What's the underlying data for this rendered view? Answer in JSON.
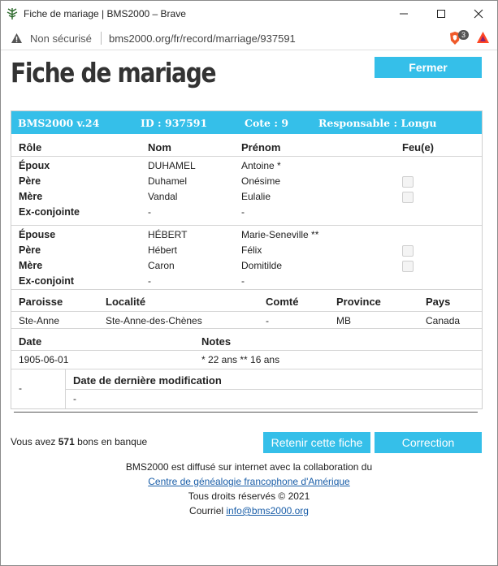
{
  "window": {
    "title": "Fiche de mariage | BMS2000 – Brave"
  },
  "addressbar": {
    "security": "Non sécurisé",
    "url": "bms2000.org/fr/record/marriage/937591",
    "shield_count": "3"
  },
  "page": {
    "title": "Fiche de mariage",
    "close_label": "Fermer",
    "record_header": {
      "version": "BMS2000 v.24",
      "id": "ID : 937591",
      "cote": "Cote : 9",
      "responsable": "Responsable : Longu"
    },
    "columns": {
      "role": "Rôle",
      "nom": "Nom",
      "prenom": "Prénom",
      "feu": "Feu(e)"
    },
    "groom": [
      {
        "role": "Époux",
        "nom": "DUHAMEL",
        "prenom": "Antoine *"
      },
      {
        "role": "Père",
        "nom": "Duhamel",
        "prenom": "Onésime"
      },
      {
        "role": "Mère",
        "nom": "Vandal",
        "prenom": "Eulalie"
      },
      {
        "role": "Ex-conjointe",
        "nom": "-",
        "prenom": "-"
      }
    ],
    "bride": [
      {
        "role": "Épouse",
        "nom": "HÉBERT",
        "prenom": "Marie-Seneville **"
      },
      {
        "role": "Père",
        "nom": "Hébert",
        "prenom": "Félix"
      },
      {
        "role": "Mère",
        "nom": "Caron",
        "prenom": "Domitilde"
      },
      {
        "role": "Ex-conjoint",
        "nom": "-",
        "prenom": "-"
      }
    ],
    "place": {
      "headers": {
        "paroisse": "Paroisse",
        "localite": "Localité",
        "comte": "Comté",
        "province": "Province",
        "pays": "Pays"
      },
      "values": {
        "paroisse": "Ste-Anne",
        "localite": "Ste-Anne-des-Chènes",
        "comte": "-",
        "province": "MB",
        "pays": "Canada"
      }
    },
    "event": {
      "headers": {
        "date": "Date",
        "notes": "Notes"
      },
      "values": {
        "date": "1905-06-01",
        "notes": "* 22 ans ** 16 ans"
      }
    },
    "modification": {
      "left": "-",
      "header": "Date de dernière modification",
      "value": "-"
    },
    "bank": {
      "prefix": "Vous avez ",
      "count": "571",
      "suffix": " bons en banque"
    },
    "keep_label": "Retenir cette fiche",
    "correction_label": "Correction",
    "footer": {
      "line1": "BMS2000 est diffusé sur internet avec la collaboration du",
      "link": "Centre de généalogie francophone d'Amérique",
      "rights": "Tous droits réservés © 2021",
      "mail_prefix": "Courriel ",
      "mail": "info@bms2000.org"
    }
  }
}
